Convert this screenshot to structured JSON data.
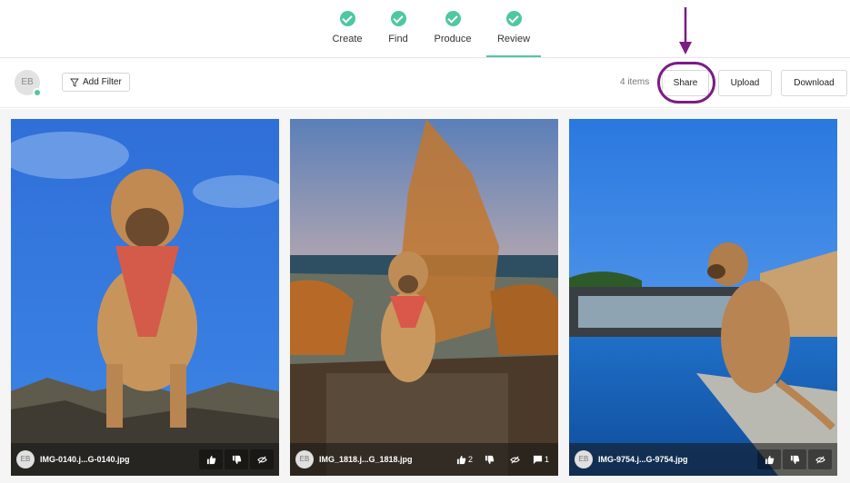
{
  "steps": [
    {
      "label": "Create"
    },
    {
      "label": "Find"
    },
    {
      "label": "Produce"
    },
    {
      "label": "Review",
      "active": true
    }
  ],
  "toolbar": {
    "avatar_initials": "EB",
    "add_filter_label": "Add Filter",
    "item_count": "4 items",
    "share_label": "Share",
    "upload_label": "Upload",
    "download_label": "Download"
  },
  "annotation": {
    "color": "#7a1d85",
    "target": "share-button"
  },
  "accent": "#4fc7a1",
  "cards": [
    {
      "initials": "EB",
      "filename": "IMG-0140.j...G-0140.jpg",
      "likes": "",
      "comments": ""
    },
    {
      "initials": "EB",
      "filename": "IMG_1818.j...G_1818.jpg",
      "likes": "2",
      "comments": "1"
    },
    {
      "initials": "EB",
      "filename": "IMG-9754.j...G-9754.jpg",
      "likes": "",
      "comments": ""
    }
  ],
  "icons": [
    "check-icon",
    "filter-icon",
    "thumbs-up-icon",
    "thumbs-down-icon",
    "hide-icon",
    "comment-icon"
  ]
}
